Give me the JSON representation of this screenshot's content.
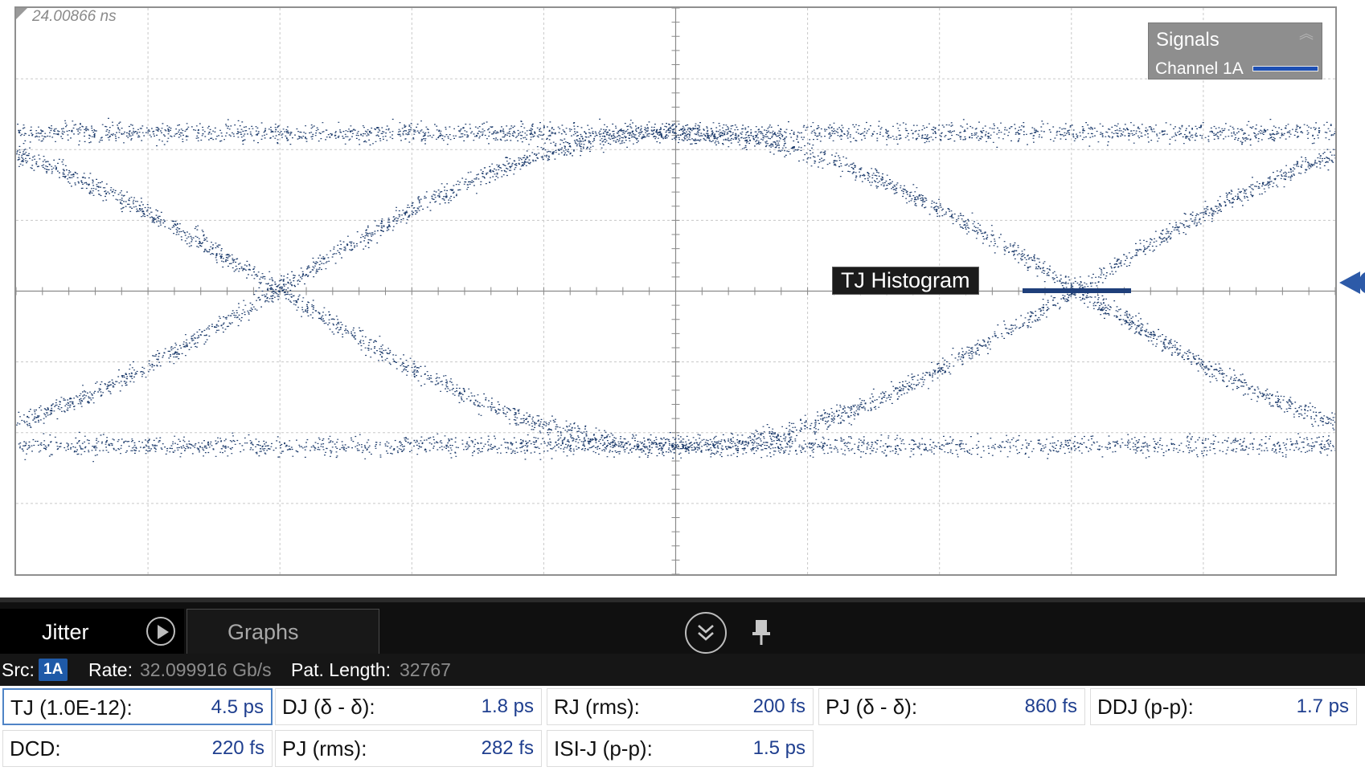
{
  "scope": {
    "timestamp": "24.00866 ns",
    "legend": {
      "title": "Signals",
      "channel": "Channel 1A",
      "channel_color": "#1d4fb3"
    },
    "histogram_label": "TJ Histogram",
    "trace_color": "#1b3a6b",
    "grid_color": "#c8c8c8"
  },
  "panel": {
    "tabs": {
      "jitter": "Jitter",
      "graphs": "Graphs"
    },
    "icons": {
      "run": "play-icon",
      "collapse": "double-chevron-down-icon",
      "pin": "pin-icon"
    },
    "src": {
      "label": "Src:",
      "value": "1A"
    },
    "rate": {
      "label": "Rate:",
      "value": "32.099916 Gb/s"
    },
    "pattern": {
      "label": "Pat. Length:",
      "value": "32767"
    },
    "measurements": [
      {
        "label": "TJ (1.0E-12):",
        "value": "4.5 ps"
      },
      {
        "label": "DJ (δ - δ):",
        "value": "1.8 ps"
      },
      {
        "label": "RJ (rms):",
        "value": "200 fs"
      },
      {
        "label": "PJ (δ - δ):",
        "value": "860 fs"
      },
      {
        "label": "DDJ (p-p):",
        "value": "1.7 ps"
      },
      {
        "label": "DCD:",
        "value": "220 fs"
      },
      {
        "label": "PJ (rms):",
        "value": "282 fs"
      },
      {
        "label": "ISI-J (p-p):",
        "value": "1.5 ps"
      }
    ]
  }
}
